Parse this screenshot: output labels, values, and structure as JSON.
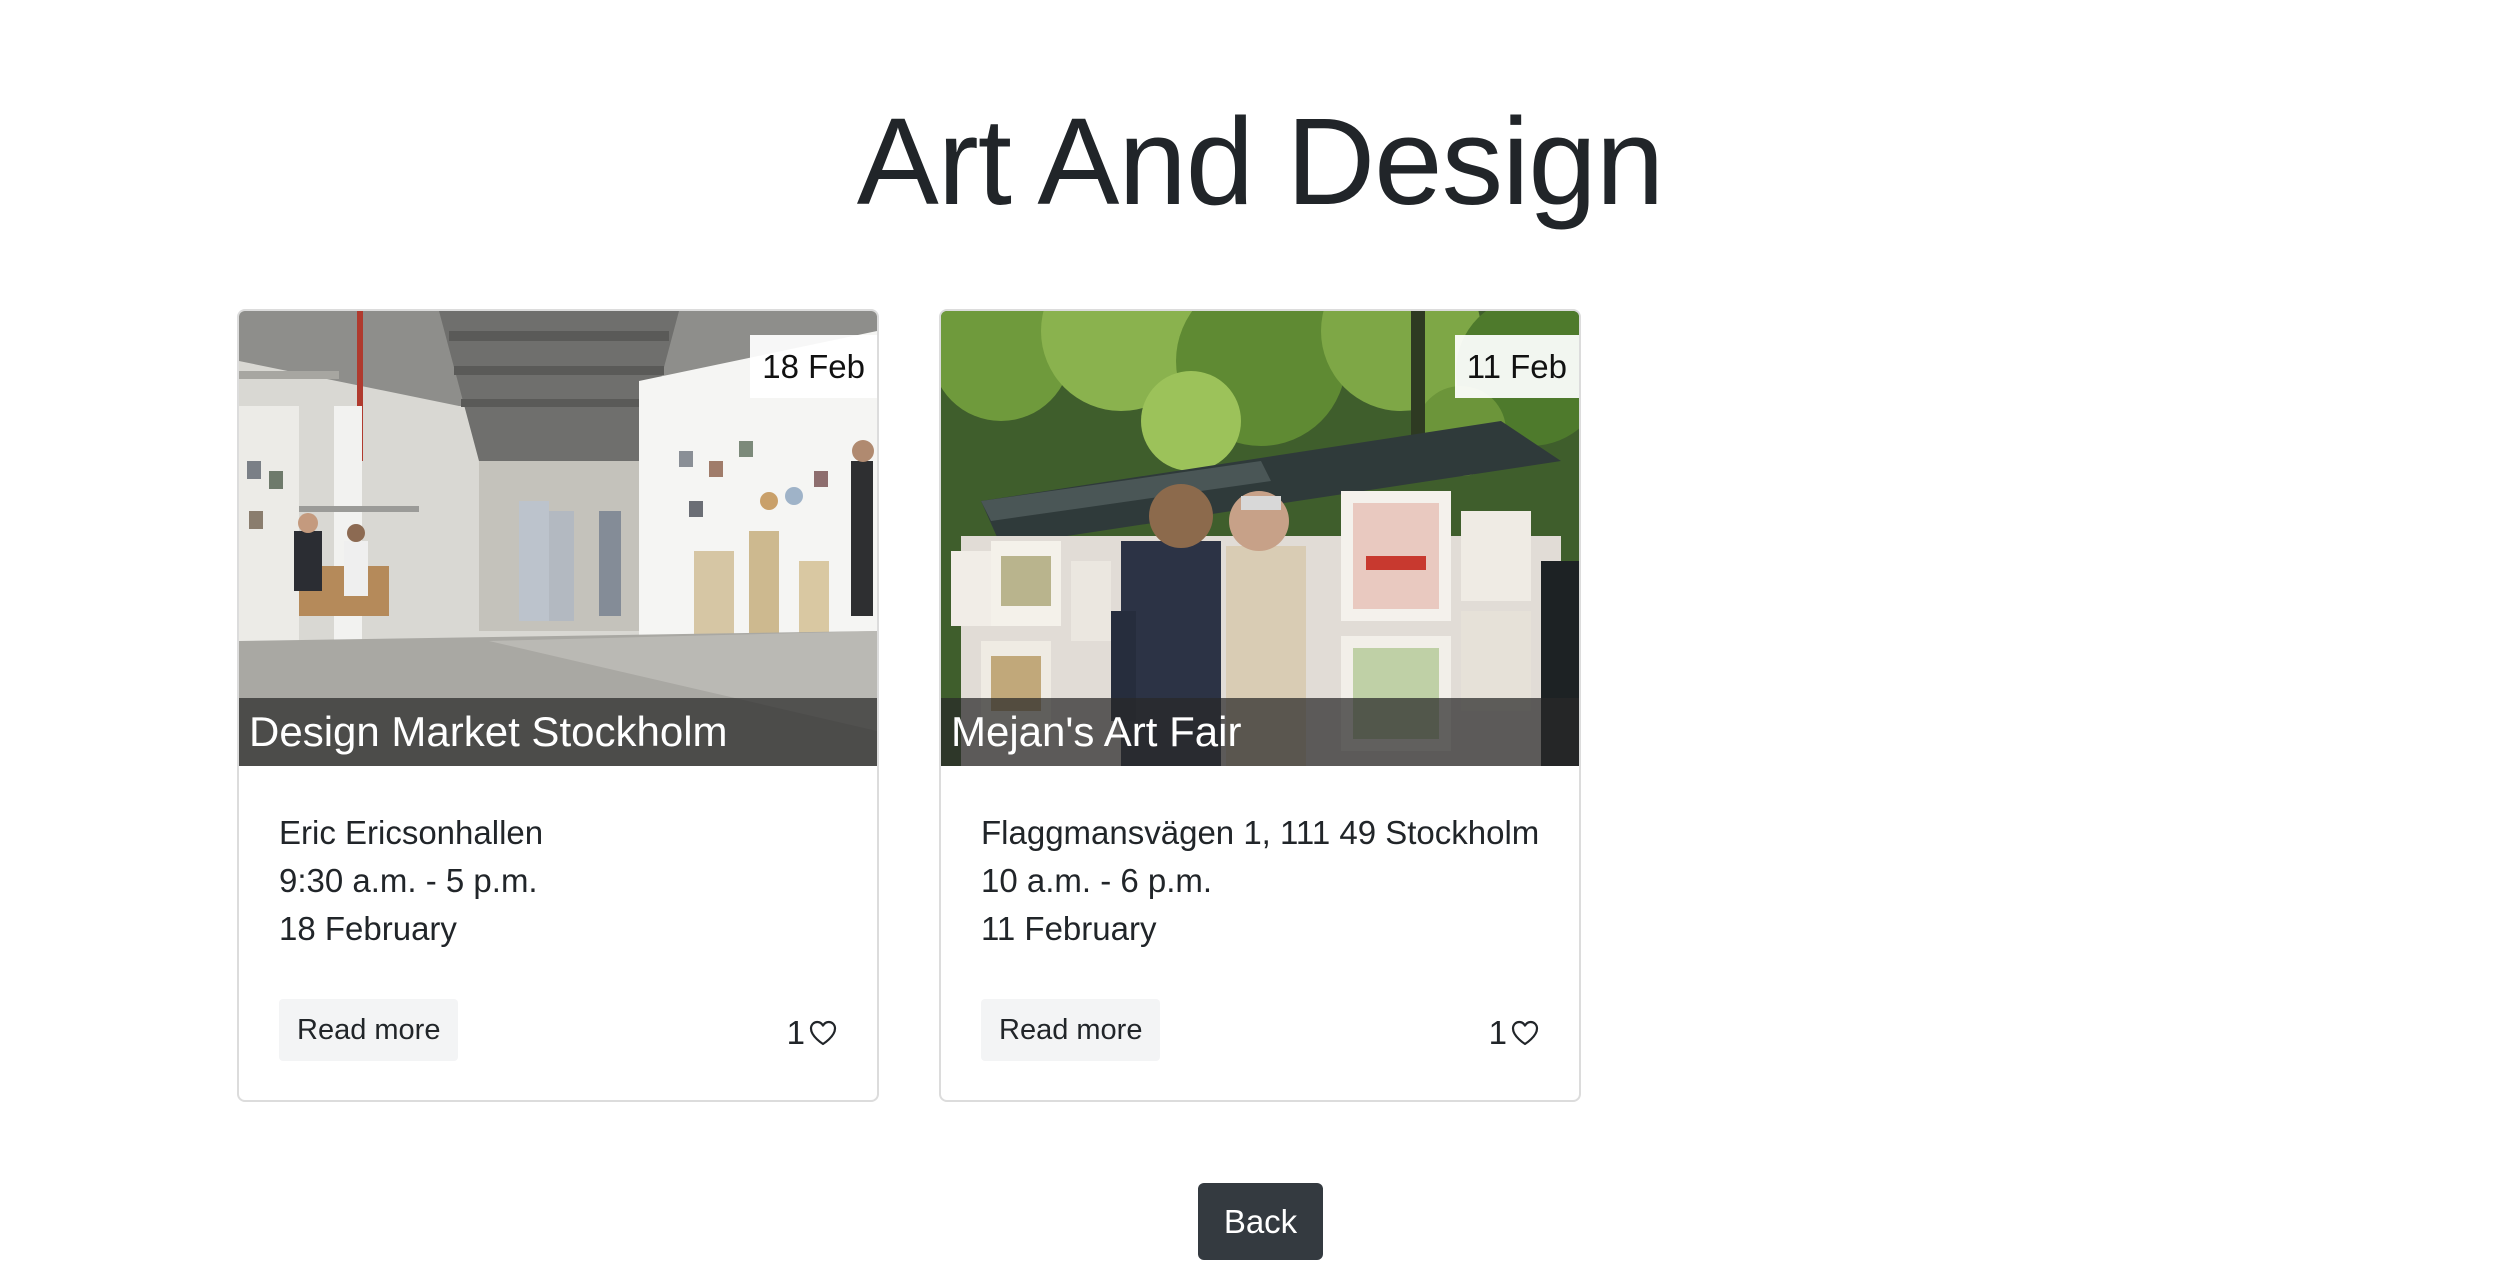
{
  "page": {
    "title": "Art And Design",
    "back_label": "Back"
  },
  "cards": [
    {
      "title": "Design Market Stockholm",
      "date_badge": "18 Feb",
      "location": "Eric Ericsonhallen",
      "hours": "9:30 a.m. - 5 p.m.",
      "date": "18 February",
      "read_more_label": "Read more",
      "likes": "1",
      "image_icon": "photo-indoor-market-hall"
    },
    {
      "title": "Mejan's Art Fair",
      "date_badge": "11 Feb",
      "location": "Flaggmansvägen 1, 111 49 Stockholm",
      "hours": "10 a.m. - 6 p.m.",
      "date": "11 February",
      "read_more_label": "Read more",
      "likes": "1",
      "image_icon": "photo-outdoor-print-stall"
    }
  ],
  "colors": {
    "back_button": "#343a40",
    "read_more_bg": "#f3f4f5",
    "caption_overlay": "#282828"
  }
}
